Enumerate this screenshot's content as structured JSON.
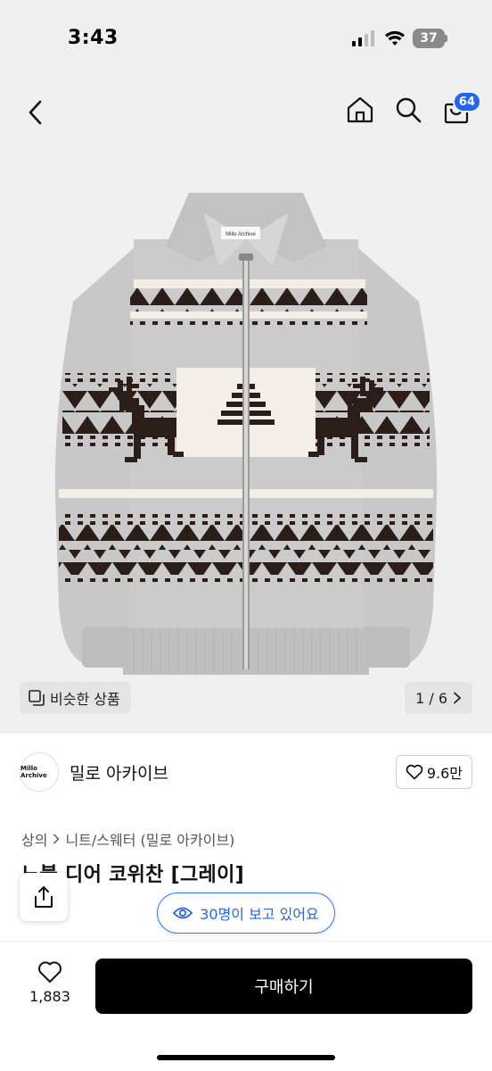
{
  "status_bar": {
    "time": "3:43",
    "battery": "37"
  },
  "nav": {
    "cart_badge": "64"
  },
  "gallery": {
    "similar_label": "비슷한 상품",
    "page_indicator": "1 / 6",
    "brand_tag": "Millo Archive"
  },
  "store": {
    "logo_text": "Millo Archive",
    "name": "밀로 아카이브",
    "likes": "9.6만"
  },
  "breadcrumb": {
    "category": "상의",
    "subcategory": "니트/스웨터 (밀로 아카이브)"
  },
  "product": {
    "title": "노블 디어 코위찬 [그레이]"
  },
  "viewers": {
    "label": "30명이 보고 있어요"
  },
  "bottom": {
    "wish_count": "1,883",
    "buy_label": "구매하기"
  },
  "colors": {
    "accent": "#1f66f5",
    "buy_button": "#000000",
    "sweater_gray": "#c9c9c9",
    "pattern_dark": "#2b1d18",
    "pattern_cream": "#f3efe6"
  }
}
